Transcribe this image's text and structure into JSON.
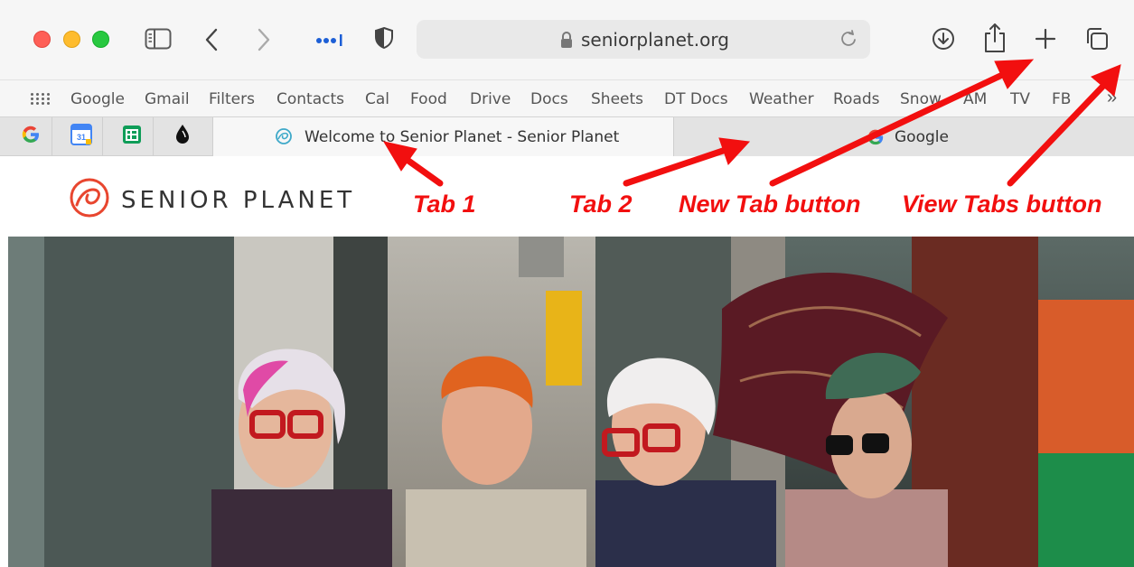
{
  "toolbar": {
    "url": "seniorplanet.org",
    "icons": [
      "sidebar-icon",
      "back-icon",
      "forward-icon",
      "extension-icon",
      "shield-icon",
      "lock-icon",
      "reload-icon",
      "download-icon",
      "share-icon",
      "new-tab-icon",
      "view-tabs-icon"
    ]
  },
  "bookmarks": {
    "items": [
      "Google",
      "Gmail",
      "Filters",
      "Contacts",
      "Cal",
      "Food",
      "Drive",
      "Docs",
      "Sheets",
      "DT Docs",
      "Weather",
      "Roads",
      "Snow",
      "AM",
      "TV",
      "FB"
    ],
    "overflow": "»"
  },
  "tabs": {
    "pinned": [
      "Google",
      "Google Calendar",
      "Google Sheets",
      "Ink"
    ],
    "tab1_title": "Welcome to Senior Planet - Senior Planet",
    "tab2_title": "Google"
  },
  "page": {
    "logo_text": "SENIOR PLANET",
    "brand_color": "#e8462f"
  },
  "annotations": {
    "tab1": "Tab 1",
    "tab2": "Tab 2",
    "new_tab": "New Tab button",
    "view_tabs": "View Tabs button",
    "color": "#f20f0f"
  }
}
